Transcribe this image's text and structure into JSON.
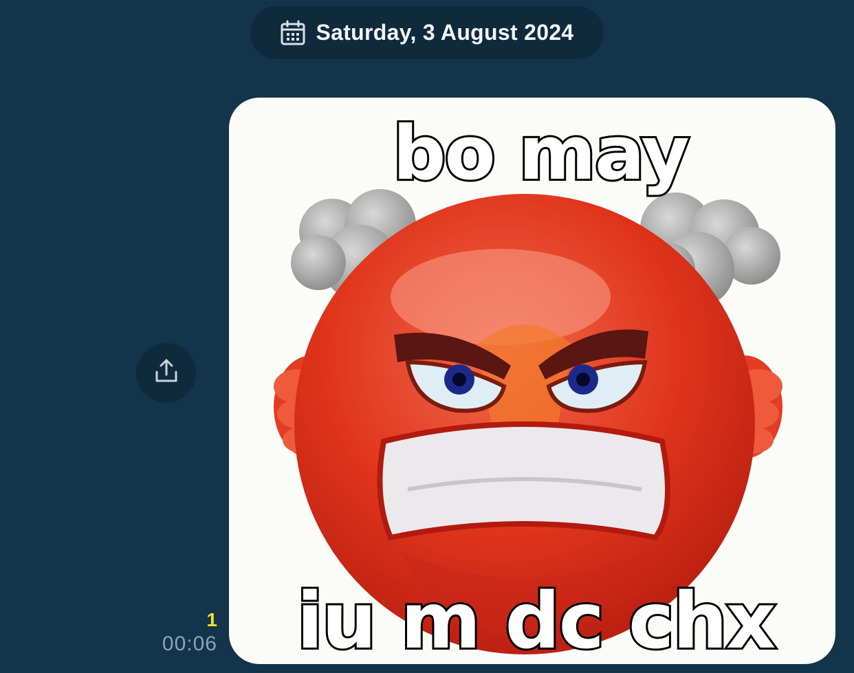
{
  "date_header": {
    "icon": "calendar-icon",
    "label": "Saturday, 3 August 2024"
  },
  "share_button": {
    "icon": "share-upload-icon"
  },
  "message": {
    "read_count": "1",
    "time": "00:06",
    "sticker": {
      "caption_top": "bo may",
      "caption_bottom": "iu m dc chx",
      "subject": "angry-red-face-emoji"
    }
  },
  "colors": {
    "background": "#13344a",
    "pill": "#0f2a3d",
    "read_count": "#f4e12a",
    "timestamp": "#8ea3b3",
    "sticker_bg": "#fbfbf8"
  }
}
